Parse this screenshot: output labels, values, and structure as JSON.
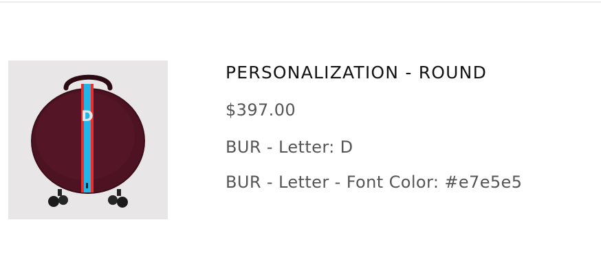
{
  "cart_item": {
    "image": {
      "icon": "round-suitcase-image",
      "monogram_letter": "D",
      "colors": {
        "shell": "#4e1322",
        "stripe_outer": "#e8312f",
        "stripe_inner": "#21b5e8",
        "monogram": "#e7e5e5",
        "background": "#e8e6e6"
      }
    },
    "title": "PERSONALIZATION - ROUND",
    "price": "$397.00",
    "options": [
      {
        "text": "BUR - Letter: D"
      },
      {
        "text": "BUR - Letter - Font Color: #e7e5e5"
      }
    ]
  }
}
